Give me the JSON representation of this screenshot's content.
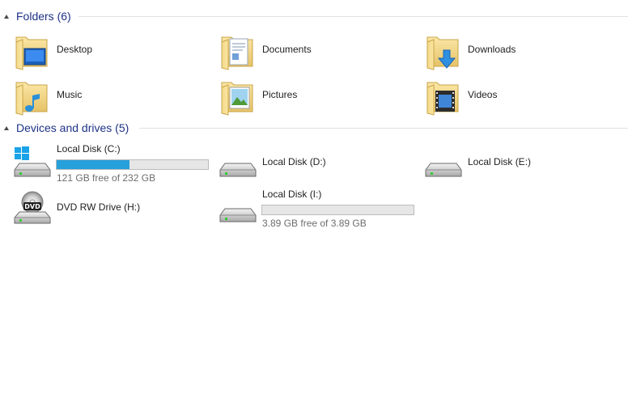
{
  "folders_group": {
    "title": "Folders (6)"
  },
  "folders": [
    {
      "name": "Desktop"
    },
    {
      "name": "Documents"
    },
    {
      "name": "Downloads"
    },
    {
      "name": "Music"
    },
    {
      "name": "Pictures"
    },
    {
      "name": "Videos"
    }
  ],
  "drives_group": {
    "title": "Devices and drives (5)"
  },
  "drives": [
    {
      "name": "Local Disk (C:)",
      "free_text": "121 GB free of 232 GB",
      "used_fraction": 0.48,
      "icon": "windows-drive-icon"
    },
    {
      "name": "Local Disk (D:)",
      "icon": "hard-drive-icon"
    },
    {
      "name": "Local Disk (E:)",
      "icon": "hard-drive-icon"
    },
    {
      "name": "DVD RW Drive (H:)",
      "icon": "dvd-drive-icon"
    },
    {
      "name": "Local Disk (I:)",
      "free_text": "3.89 GB free of 3.89 GB",
      "used_fraction": 0.0,
      "icon": "hard-drive-icon"
    }
  ],
  "colors": {
    "group_title": "#1e3287",
    "bar_fill": "#26a0da",
    "bar_bg": "#e6e6e6"
  }
}
